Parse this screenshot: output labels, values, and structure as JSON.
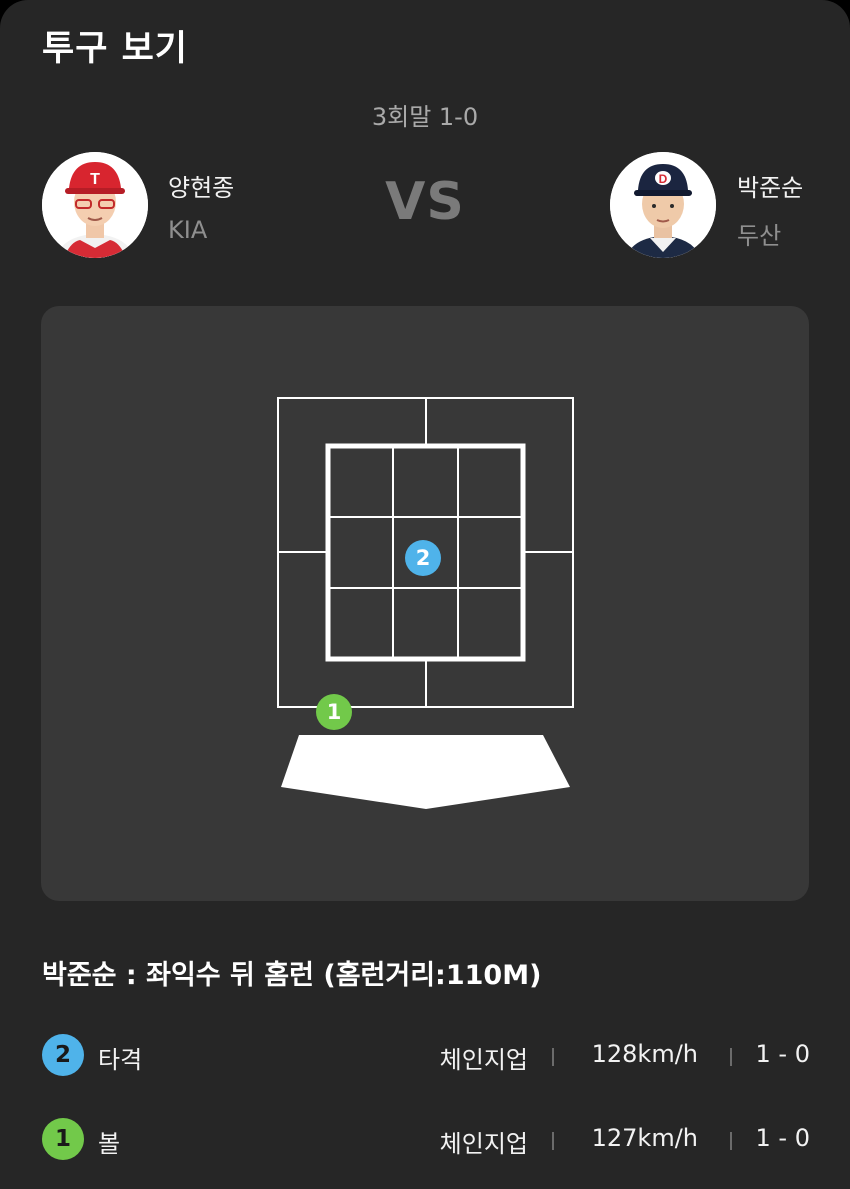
{
  "header": {
    "title": "투구 보기"
  },
  "inning": "3회말 1-0",
  "vs_label": "VS",
  "pitcher": {
    "name": "양현종",
    "team": "KIA",
    "avatar": "player-photo-kia"
  },
  "batter": {
    "name": "박준순",
    "team": "두산",
    "avatar": "player-photo-doosan"
  },
  "strike_zone": {
    "pitches": [
      {
        "number": "1",
        "type": "ball",
        "color": "#72c94a"
      },
      {
        "number": "2",
        "type": "hit",
        "color": "#4fb3ea"
      }
    ]
  },
  "result_text": "박준순 : 좌익수 뒤 홈런 (홈런거리:110M)",
  "pitch_list": [
    {
      "number": "2",
      "type": "타격",
      "pitch": "체인지업",
      "speed": "128km/h",
      "count": "1 - 0",
      "color": "#4fb3ea"
    },
    {
      "number": "1",
      "type": "볼",
      "pitch": "체인지업",
      "speed": "127km/h",
      "count": "1 - 0",
      "color": "#72c94a"
    }
  ],
  "colors": {
    "background": "#262626",
    "panel": "#383838",
    "ball": "#72c94a",
    "hit": "#4fb3ea"
  }
}
